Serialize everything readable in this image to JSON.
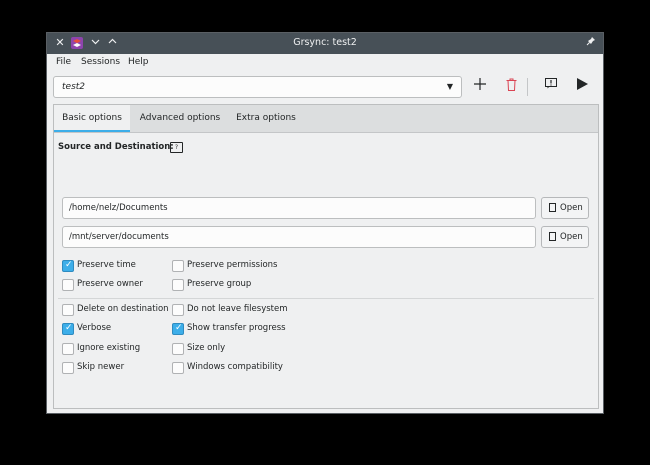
{
  "window": {
    "title": "Grsync: test2",
    "buttons": {
      "close": "✕",
      "minimize": "⌄",
      "maximize": "⌃",
      "pin": "📌"
    }
  },
  "menu": {
    "file": "File",
    "sessions": "Sessions",
    "help": "Help"
  },
  "toolbar": {
    "session": "test2",
    "icons": [
      "add-session-icon",
      "delete-session-icon",
      "simulate-icon",
      "run-icon"
    ]
  },
  "tabs": [
    {
      "label": "Basic options",
      "active": true
    },
    {
      "label": "Advanced options",
      "active": false
    },
    {
      "label": "Extra options",
      "active": false
    }
  ],
  "source_destination": {
    "label": "Source and Destination:",
    "source": "/home/nelz/Documents",
    "destination": "/mnt/server/documents",
    "open_label": "Open"
  },
  "options_top": [
    {
      "label": "Preserve time",
      "checked": true
    },
    {
      "label": "Preserve permissions",
      "checked": false
    },
    {
      "label": "Preserve owner",
      "checked": false
    },
    {
      "label": "Preserve group",
      "checked": false
    }
  ],
  "options_bottom": [
    {
      "label": "Delete on destination",
      "checked": false
    },
    {
      "label": "Do not leave filesystem",
      "checked": false
    },
    {
      "label": "Verbose",
      "checked": true
    },
    {
      "label": "Show transfer progress",
      "checked": true
    },
    {
      "label": "Ignore existing",
      "checked": false
    },
    {
      "label": "Size only",
      "checked": false
    },
    {
      "label": "Skip newer",
      "checked": false
    },
    {
      "label": "Windows compatibility",
      "checked": false
    }
  ],
  "colors": {
    "accent": "#3daee9",
    "titlebar": "#475057",
    "window_bg": "#eff0f1",
    "delete": "#da4453"
  }
}
